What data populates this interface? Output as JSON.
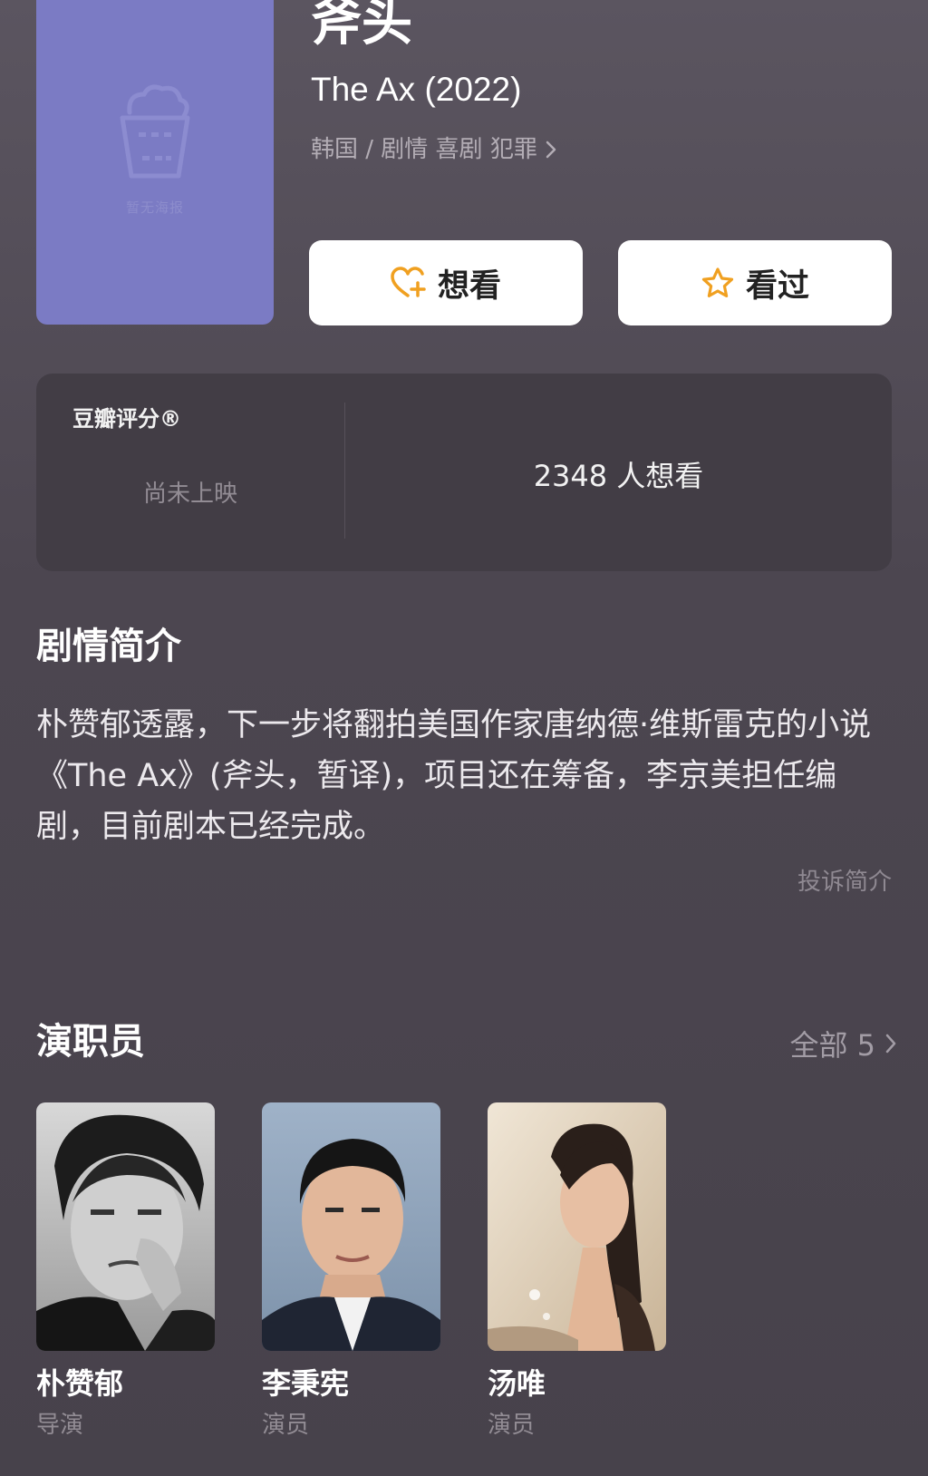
{
  "poster": {
    "caption": "暂无海报"
  },
  "movie": {
    "title": "斧头",
    "subtitle": "The Ax (2022)",
    "meta": "韩国 / 剧情 喜剧 犯罪"
  },
  "actions": {
    "want_label": "想看",
    "seen_label": "看过"
  },
  "rating": {
    "label": "豆瓣评分®",
    "status": "尚未上映",
    "wish_count": "2348 人想看"
  },
  "synopsis": {
    "heading": "剧情简介",
    "text": "朴赞郁透露，下一步将翻拍美国作家唐纳德·维斯雷克的小说《The Ax》(斧头，暂译)，项目还在筹备，李京美担任编剧，目前剧本已经完成。",
    "complain_label": "投诉简介"
  },
  "cast": {
    "heading": "演职员",
    "all_label": "全部 5",
    "members": [
      {
        "name": "朴赞郁",
        "role": "导演"
      },
      {
        "name": "李秉宪",
        "role": "演员"
      },
      {
        "name": "汤唯",
        "role": "演员"
      }
    ]
  },
  "colors": {
    "accent": "#f0a020",
    "poster": "#7b7bc4",
    "panel": "#423d45"
  }
}
